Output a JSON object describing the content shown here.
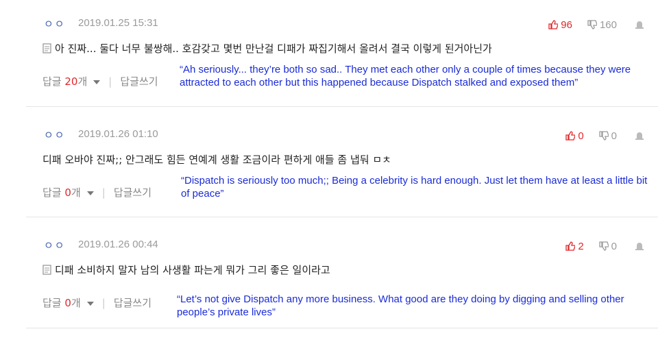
{
  "colors": {
    "accent_up": "#e0262a",
    "translation": "#1a2bd6",
    "nick": "#4a66b3"
  },
  "comments": [
    {
      "nick": "ㅇㅇ",
      "date": "2019.01.25 15:31",
      "up": "96",
      "down": "160",
      "text": "아 진짜... 둘다 너무 불쌍해.. 호감갖고 몇번 만난걸 디패가 짜집기해서 올려서 결국 이렇게 된거아닌가",
      "reply_label": "답글",
      "reply_count": "20",
      "reply_unit": "개",
      "write_label": "답글쓰기",
      "translation": "“Ah seriously... they’re both so sad.. They met each other only a couple of times because they were attracted to each other but this happened because Dispatch stalked and exposed them”"
    },
    {
      "nick": "ㅇㅇ",
      "date": "2019.01.26 01:10",
      "up": "0",
      "down": "0",
      "text": "디패 오바야 진짜;; 안그래도 힘든 연예계 생활 조금이라 편하게 애들 좀 냅둬 ㅁㅊ",
      "reply_label": "답글",
      "reply_count": "0",
      "reply_unit": "개",
      "write_label": "답글쓰기",
      "translation": "“Dispatch is seriously too much;; Being a celebrity is hard enough. Just let them have at least a little bit of peace”"
    },
    {
      "nick": "ㅇㅇ",
      "date": "2019.01.26 00:44",
      "up": "2",
      "down": "0",
      "text": "디패 소비하지 말자 남의 사생활 파는게 뭐가 그리 좋은 일이라고",
      "reply_label": "답글",
      "reply_count": "0",
      "reply_unit": "개",
      "write_label": "답글쓰기",
      "translation": "“Let’s not give Dispatch any more business. What good are they doing by digging and selling other people’s private lives”"
    }
  ]
}
